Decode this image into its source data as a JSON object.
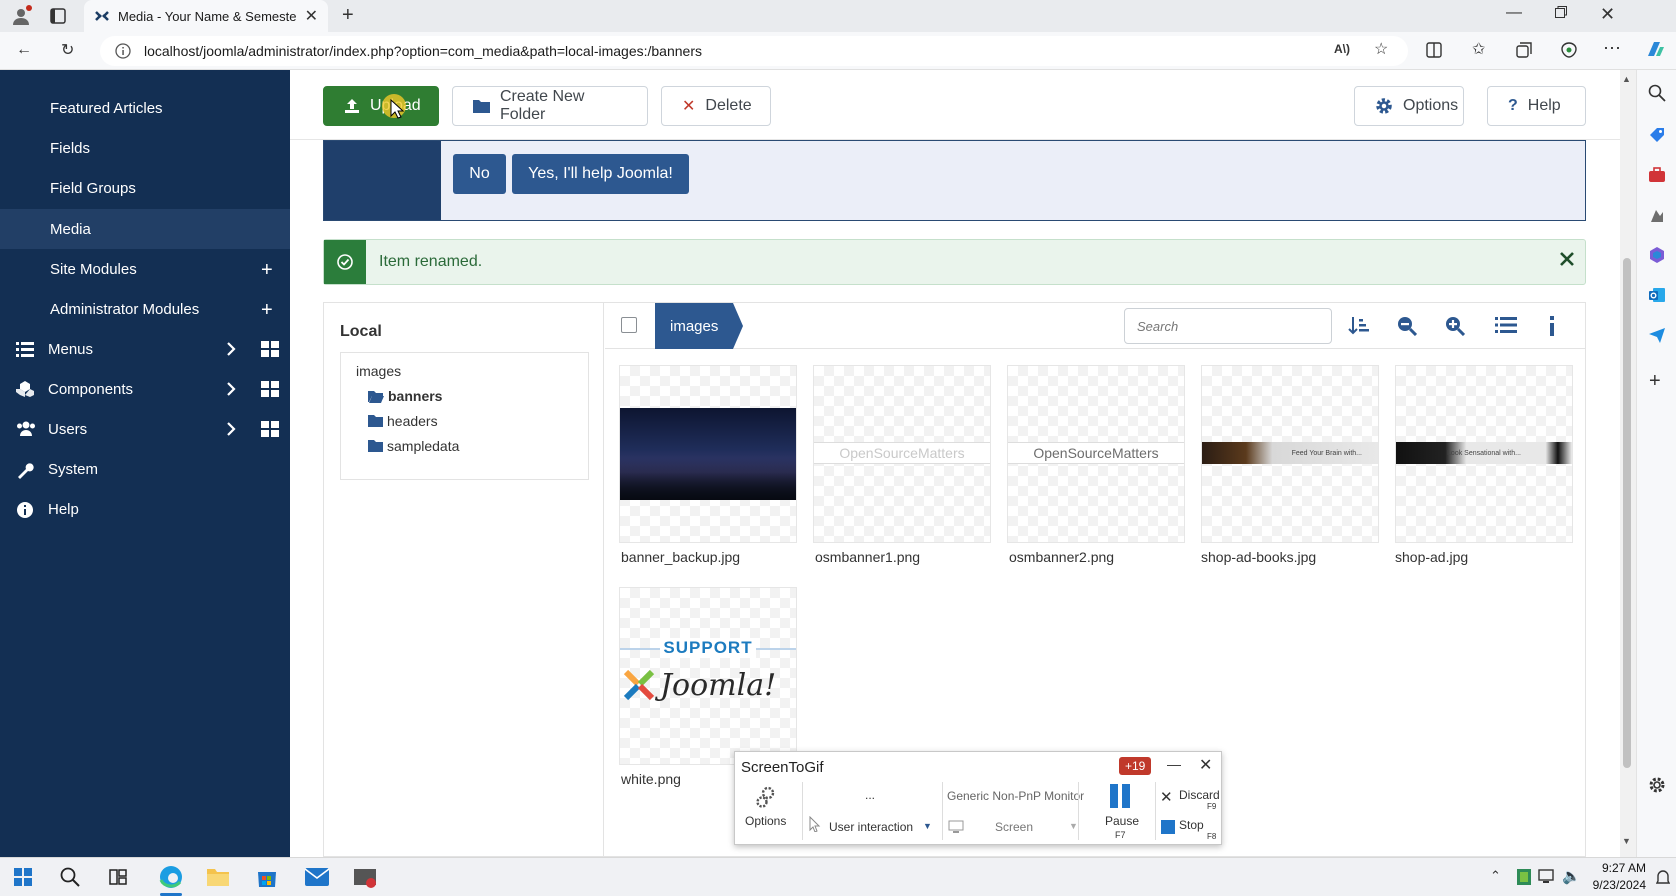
{
  "browser": {
    "tab_title": "Media - Your Name & Semester y",
    "url": "localhost/joomla/administrator/index.php?option=com_media&path=local-images:/banners"
  },
  "sidebar": {
    "items": [
      {
        "label": "Featured Articles"
      },
      {
        "label": "Fields"
      },
      {
        "label": "Field Groups"
      },
      {
        "label": "Media"
      },
      {
        "label": "Site Modules"
      },
      {
        "label": "Administrator Modules"
      },
      {
        "label": "Menus"
      },
      {
        "label": "Components"
      },
      {
        "label": "Users"
      },
      {
        "label": "System"
      },
      {
        "label": "Help"
      }
    ]
  },
  "toolbar": {
    "upload": "Upload",
    "new_folder": "Create New Folder",
    "delete": "Delete",
    "options": "Options",
    "help": "Help"
  },
  "banner": {
    "no": "No",
    "yes": "Yes, I'll help Joomla!"
  },
  "alert": {
    "message": "Item renamed."
  },
  "media": {
    "location": "Local",
    "tree": {
      "root": "images",
      "folders": [
        "banners",
        "headers",
        "sampledata"
      ]
    },
    "breadcrumb": "images",
    "search_placeholder": "Search",
    "files": [
      {
        "name": "banner_backup.jpg"
      },
      {
        "name": "osmbanner1.png",
        "thumb_text": "OpenSourceMatters"
      },
      {
        "name": "osmbanner2.png",
        "thumb_text": "OpenSourceMatters"
      },
      {
        "name": "shop-ad-books.jpg",
        "thumb_text": "Feed Your Brain with..."
      },
      {
        "name": "shop-ad.jpg",
        "thumb_text": "Look Sensational with..."
      },
      {
        "name": "white.png",
        "thumb_text": "SUPPORT",
        "thumb_text2": "Joomla!"
      }
    ]
  },
  "screentogif": {
    "title": "ScreenToGif",
    "badge": "+19",
    "options": "Options",
    "ellipsis": "...",
    "user_interaction": "User interaction",
    "monitor": "Generic Non-PnP Monitor",
    "screen": "Screen",
    "pause": "Pause",
    "pause_key": "F7",
    "discard": "Discard",
    "discard_key": "F9",
    "stop": "Stop",
    "stop_key": "F8"
  },
  "taskbar": {
    "time": "9:27 AM",
    "date": "9/23/2024"
  },
  "colors": {
    "sidebar": "#132f53",
    "primary": "#2d5890",
    "success": "#2f7d32"
  }
}
